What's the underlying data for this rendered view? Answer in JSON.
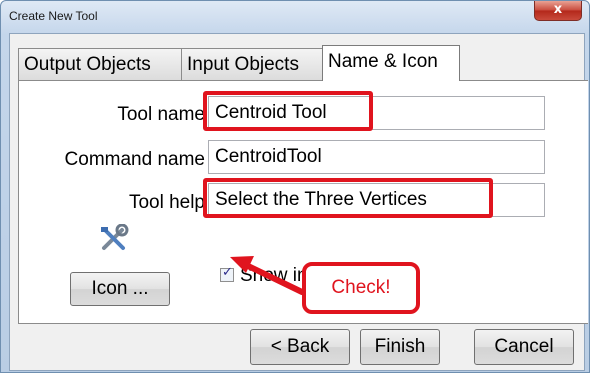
{
  "window": {
    "title": "Create New Tool",
    "close_symbol": "x"
  },
  "tabs": [
    {
      "label": "Output Objects",
      "active": false
    },
    {
      "label": "Input Objects",
      "active": false
    },
    {
      "label": "Name & Icon",
      "active": true
    }
  ],
  "form": {
    "tool_name_label": "Tool name",
    "tool_name_value": "Centroid Tool",
    "command_name_label": "Command name",
    "command_name_value": "CentroidTool",
    "tool_help_label": "Tool help",
    "tool_help_value": "Select the Three Vertices",
    "show_in_toolbar_label": "Show in Toolbar",
    "show_in_toolbar_checked": true,
    "icon_button_label": "Icon ...",
    "icon_name": "tools-icon"
  },
  "footer": {
    "back_label": "< Back",
    "finish_label": "Finish",
    "cancel_label": "Cancel"
  },
  "annotation": {
    "callout_text": "Check!",
    "highlight_color": "#e0141e"
  }
}
